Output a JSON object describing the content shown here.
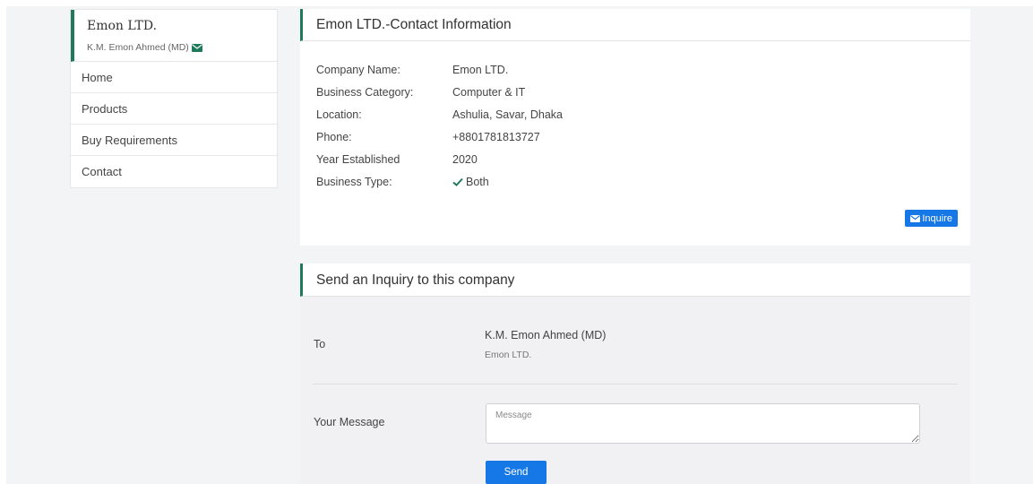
{
  "sidebar": {
    "company": "Emon LTD.",
    "owner": "K.M. Emon Ahmed (MD)",
    "items": [
      {
        "label": "Home"
      },
      {
        "label": "Products"
      },
      {
        "label": "Buy Requirements"
      },
      {
        "label": "Contact"
      }
    ]
  },
  "contact": {
    "title": "Emon LTD.-Contact Information",
    "rows": [
      {
        "label": "Company Name:",
        "value": "Emon LTD."
      },
      {
        "label": "Business Category:",
        "value": "Computer & IT"
      },
      {
        "label": "Location:",
        "value": "Ashulia, Savar, Dhaka"
      },
      {
        "label": "Phone:",
        "value": "+8801781813727"
      },
      {
        "label": "Year Established",
        "value": "2020"
      },
      {
        "label": "Business Type:",
        "value": "Both"
      }
    ],
    "inquire_label": "Inquire"
  },
  "inquiry": {
    "title": "Send an Inquiry to this company",
    "to_label": "To",
    "to_name": "K.M. Emon Ahmed (MD)",
    "to_company": "Emon LTD.",
    "message_label": "Your Message",
    "message_placeholder": "Message",
    "message_value": "",
    "send_label": "Send"
  },
  "colors": {
    "accent_green": "#1f7a5c",
    "button_blue": "#1677e6",
    "check_green": "#1f7a5c"
  },
  "icons": {
    "envelope": "envelope-icon",
    "check": "check-icon"
  }
}
